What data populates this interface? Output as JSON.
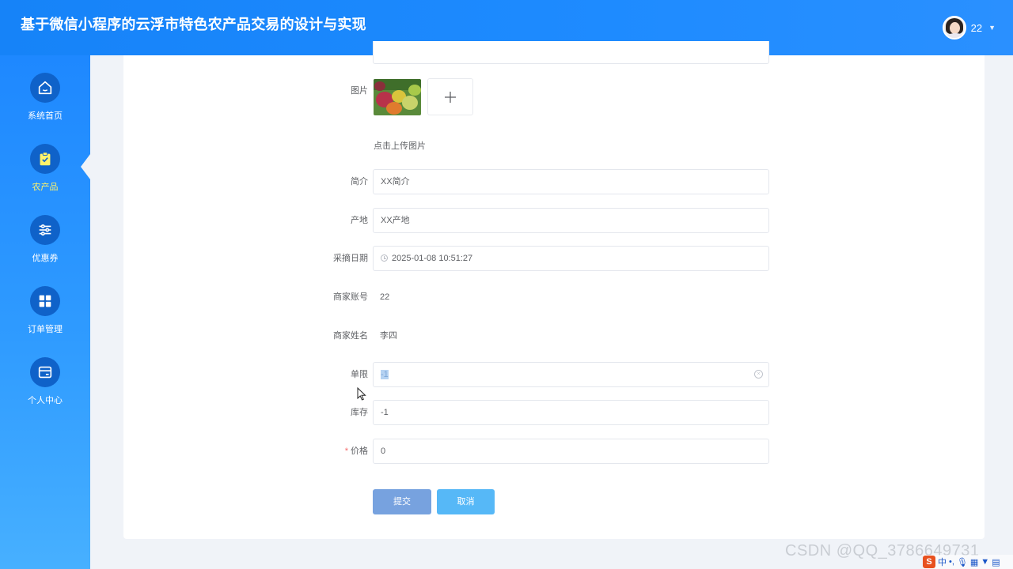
{
  "header": {
    "title": "基于微信小程序的云浮市特色农产品交易的设计与实现",
    "user_name": "22"
  },
  "sidebar": {
    "items": [
      {
        "label": "系统首页",
        "icon": "home-icon"
      },
      {
        "label": "农产品",
        "icon": "clipboard-check-icon",
        "active": true
      },
      {
        "label": "优惠券",
        "icon": "sliders-icon"
      },
      {
        "label": "订单管理",
        "icon": "grid-icon"
      },
      {
        "label": "个人中心",
        "icon": "card-icon"
      }
    ]
  },
  "form": {
    "image_label": "图片",
    "upload_tip": "点击上传图片",
    "intro_label": "简介",
    "intro_value": "XX简介",
    "origin_label": "产地",
    "origin_value": "XX产地",
    "pick_date_label": "采摘日期",
    "pick_date_value": "2025-01-08 10:51:27",
    "merchant_account_label": "商家账号",
    "merchant_account_value": "22",
    "merchant_name_label": "商家姓名",
    "merchant_name_value": "李四",
    "limit_label": "单限",
    "limit_value": "-1",
    "stock_label": "库存",
    "stock_value": "-1",
    "price_required": "*",
    "price_label": "价格",
    "price_value": "0"
  },
  "buttons": {
    "submit": "提交",
    "cancel": "取消"
  },
  "watermark": "CSDN @QQ_3786649731",
  "ime": {
    "logo": "S",
    "lang": "中"
  },
  "colors": {
    "header": "#1e8bff",
    "nav_icon_bg": "#0f62c9",
    "active_label": "#fff36b",
    "submit_button": "#77a2df",
    "cancel_button": "#56b8f7"
  }
}
